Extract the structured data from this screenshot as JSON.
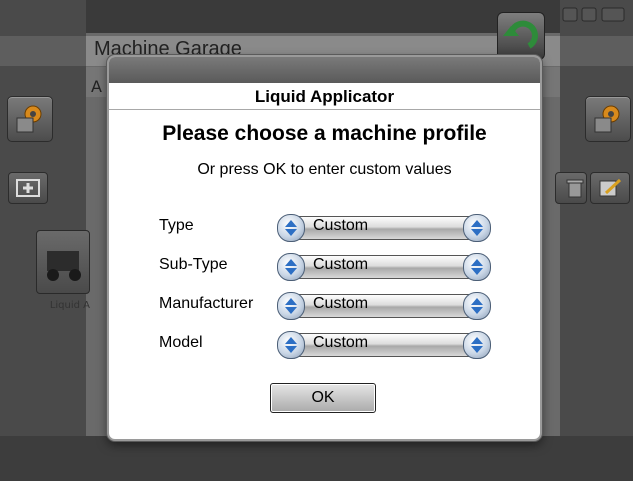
{
  "background": {
    "title": "Machine Garage",
    "subtitle_fragment": "A",
    "machine_label": "Liquid A"
  },
  "dialog": {
    "header": "Liquid Applicator",
    "heading": "Please choose a machine profile",
    "subheading": "Or press OK to enter custom values",
    "fields": [
      {
        "label": "Type",
        "value": "Custom"
      },
      {
        "label": "Sub-Type",
        "value": "Custom"
      },
      {
        "label": "Manufacturer",
        "value": "Custom"
      },
      {
        "label": "Model",
        "value": "Custom"
      }
    ],
    "ok_label": "OK"
  },
  "icons": {
    "back": "back-arrow-icon",
    "left_settings": "gear-settings-icon",
    "right_settings": "gear-settings-icon",
    "add": "add-icon",
    "delete": "trash-icon",
    "edit": "edit-icon",
    "spinner_left": "chevron-up-down-icon",
    "spinner_right": "chevron-up-down-icon"
  },
  "colors": {
    "back_arrow": "#2e8b3a",
    "gear": "#d88a1c",
    "spinner_arrow": "#2d6fc4"
  }
}
